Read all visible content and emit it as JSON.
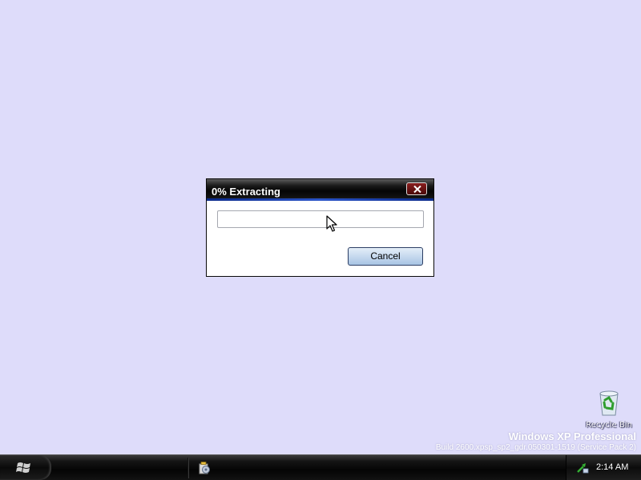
{
  "desktop": {
    "background": "#dedcfa",
    "icons": [
      {
        "label": "Recycle Bin",
        "icon": "recycle-bin-icon"
      }
    ],
    "watermark": {
      "title": "Windows XP Professional",
      "build": "Build 2600.xpsp_sp2_gdr.050301-1519 (Service Pack 2)"
    }
  },
  "dialog": {
    "title": "0% Extracting",
    "progress": 0,
    "progress_color": "#3c8c3c",
    "buttons": {
      "cancel": "Cancel",
      "close_icon": "close-icon"
    }
  },
  "taskbar": {
    "start_icon": "windows-logo-icon",
    "quick_launch_icon": "installer-icon",
    "tray_icon": "network-icon",
    "clock": "2:14 AM"
  }
}
